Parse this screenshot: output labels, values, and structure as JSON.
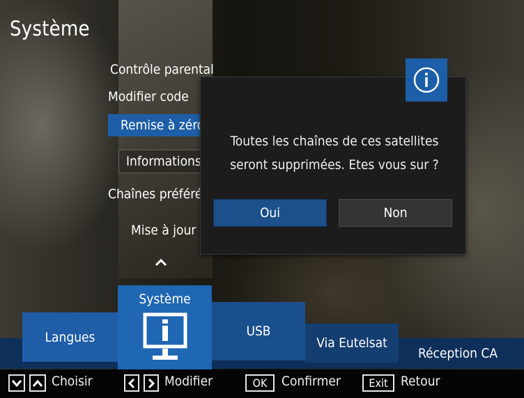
{
  "screen": {
    "title": "Système"
  },
  "menu": {
    "items": [
      {
        "label": "Contrôle parental"
      },
      {
        "label": "Modifier code"
      },
      {
        "label": "Remise à zéro"
      },
      {
        "label": "Informations"
      },
      {
        "label": "Chaînes préférées"
      },
      {
        "label": "Mise à jour"
      }
    ],
    "selected_index": 2,
    "scroll_up_icon": "chevron-up-icon"
  },
  "dialog": {
    "icon": "info-icon",
    "message_line1": "Toutes les chaînes de ces satellites",
    "message_line2": "seront supprimées. Etes vous sur ?",
    "yes_label": "Oui",
    "no_label": "Non",
    "focused": "yes"
  },
  "tabs": [
    {
      "label": "Langues"
    },
    {
      "label": "Système",
      "icon": "monitor-info-icon",
      "active": true
    },
    {
      "label": "USB"
    },
    {
      "label": "Via Eutelsat"
    },
    {
      "label": "Réception CA"
    }
  ],
  "helper": {
    "choose_label": "Choisir",
    "modify_label": "Modifier",
    "ok_key": "OK",
    "confirm_label": "Confirmer",
    "exit_key": "Exit",
    "back_label": "Retour"
  },
  "colors": {
    "accent_blue": "#1f66b3",
    "selected_blue": "#1e5ea6",
    "dialog_bg": "#1c1c1c"
  }
}
